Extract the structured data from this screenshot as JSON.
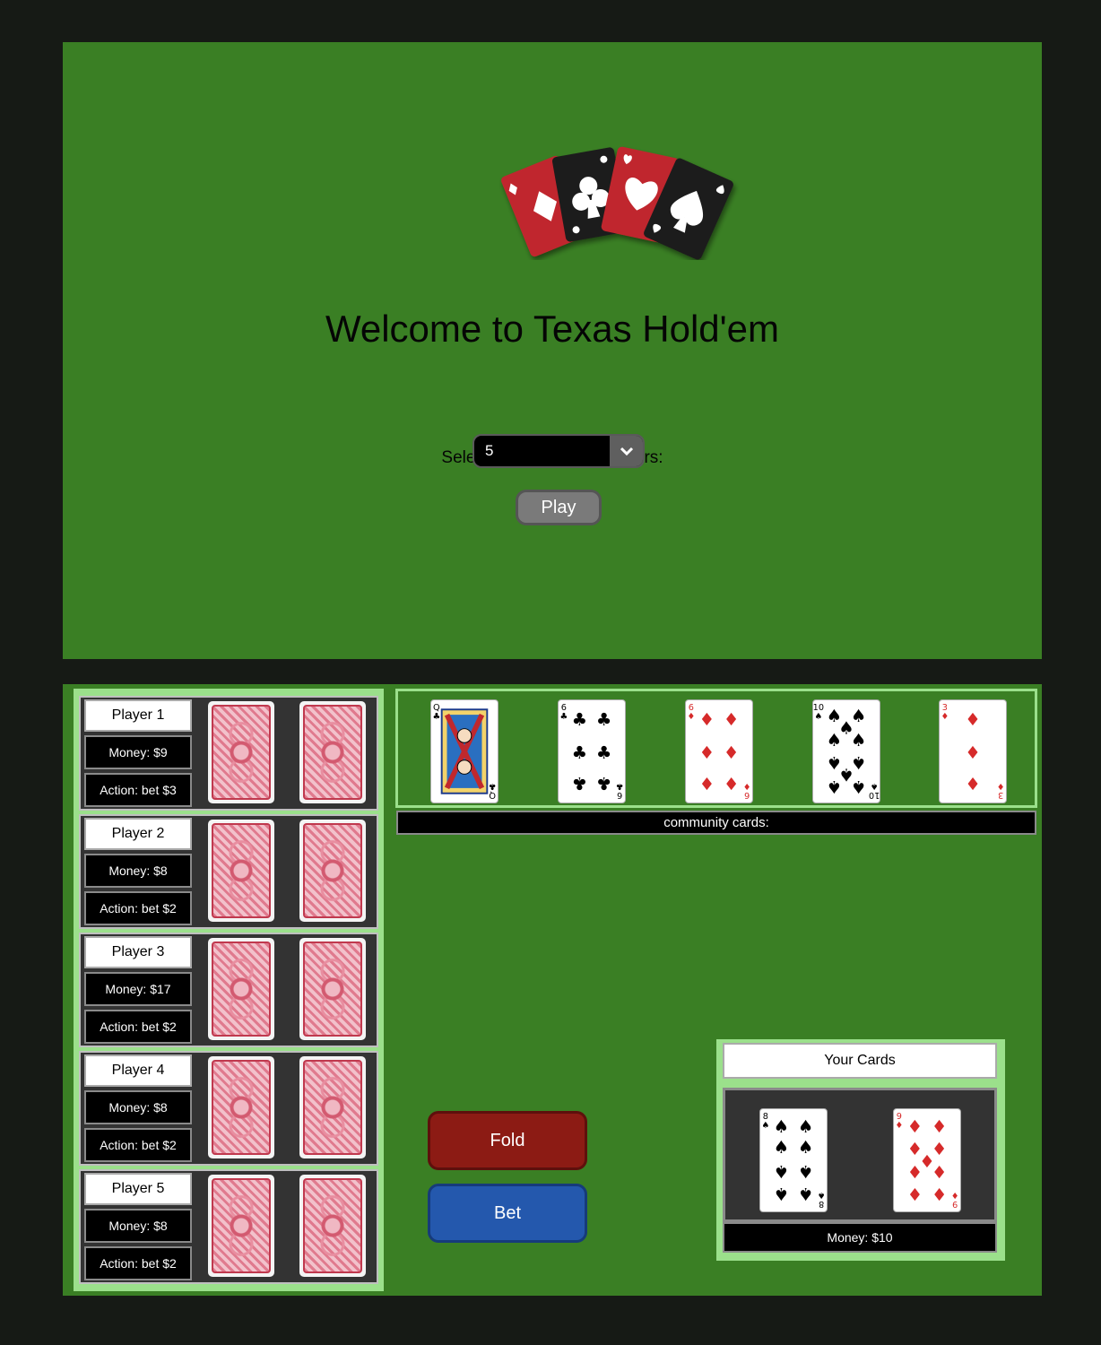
{
  "setup": {
    "title": "Welcome to Texas Hold'em",
    "select_label": "Select number of bot players:",
    "bot_count": "5",
    "play_label": "Play"
  },
  "players": [
    {
      "name": "Player 1",
      "money": "Money: $9",
      "action": "Action: bet $3"
    },
    {
      "name": "Player 2",
      "money": "Money: $8",
      "action": "Action: bet $2"
    },
    {
      "name": "Player 3",
      "money": "Money: $17",
      "action": "Action: bet $2"
    },
    {
      "name": "Player 4",
      "money": "Money: $8",
      "action": "Action: bet $2"
    },
    {
      "name": "Player 5",
      "money": "Money: $8",
      "action": "Action: bet $2"
    }
  ],
  "community": {
    "label": "community cards:",
    "cards": [
      {
        "rank": "Q",
        "suit": "clubs"
      },
      {
        "rank": "6",
        "suit": "clubs"
      },
      {
        "rank": "6",
        "suit": "diamonds"
      },
      {
        "rank": "10",
        "suit": "spades"
      },
      {
        "rank": "3",
        "suit": "diamonds"
      }
    ]
  },
  "controls": {
    "fold_label": "Fold",
    "bet_label": "Bet"
  },
  "your_hand": {
    "title": "Your Cards",
    "money": "Money: $10",
    "cards": [
      {
        "rank": "8",
        "suit": "spades"
      },
      {
        "rank": "9",
        "suit": "diamonds"
      }
    ]
  },
  "colors": {
    "table_green": "#3a7f24",
    "frame_green": "#9be08b",
    "fold_red": "#8c1b14",
    "bet_blue": "#2458ad",
    "red_suit": "#d62a2a",
    "black_suit": "#000000"
  }
}
